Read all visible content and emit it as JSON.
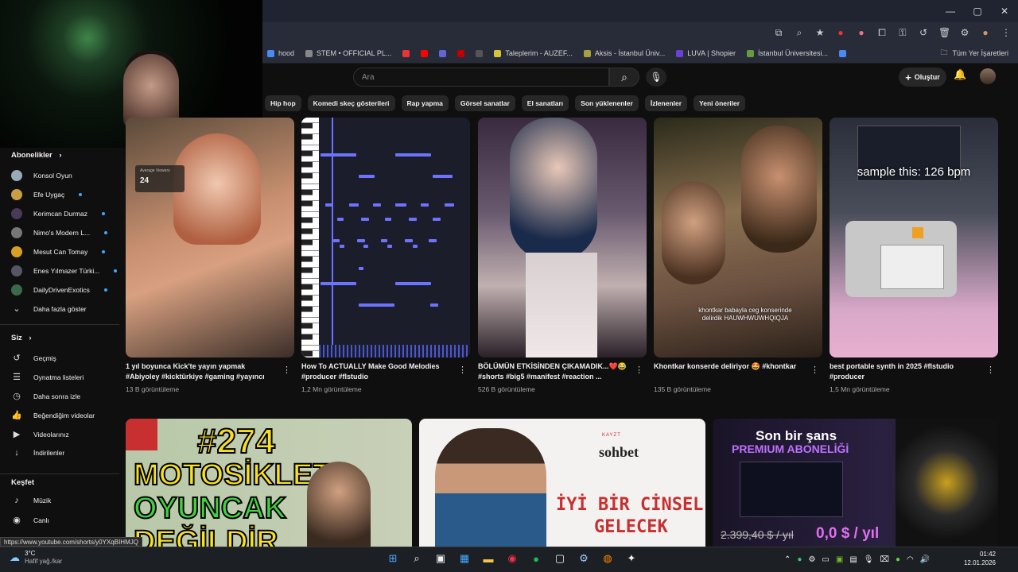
{
  "browser": {
    "window_controls": [
      "—",
      "▢",
      "✕"
    ],
    "bookmarks": [
      {
        "label": "hood",
        "color": "#4a8af4"
      },
      {
        "label": "STEM • OFFICIAL PL...",
        "color": "#888888"
      },
      {
        "label": "",
        "color": "#e33"
      },
      {
        "label": "",
        "color": "#ff0000"
      },
      {
        "label": "",
        "color": "#6264d8"
      },
      {
        "label": "",
        "color": "#c00000"
      },
      {
        "label": "",
        "color": "#555"
      },
      {
        "label": "Taleplerim - AUZEF...",
        "color": "#d4c43a"
      },
      {
        "label": "Aksis - İstanbul Üniv...",
        "color": "#a8a040"
      },
      {
        "label": "LUVA | Shopier",
        "color": "#6b3fd8"
      },
      {
        "label": "İstanbul Üniversitesi...",
        "color": "#6a9a40"
      },
      {
        "label": "",
        "color": "#4a8af4"
      }
    ],
    "all_bookmarks_label": "Tüm Yer İşaretleri",
    "status_url": "https://www.youtube.com/shorts/y0YXqBIHMJQ"
  },
  "header": {
    "search_placeholder": "Ara",
    "create_label": "Oluştur"
  },
  "chips": [
    "Hip hop",
    "Komedi skeç gösterileri",
    "Rap yapma",
    "Görsel sanatlar",
    "El sanatları",
    "Son yüklenenler",
    "İzlenenler",
    "Yeni öneriler"
  ],
  "sidebar": {
    "subscriptions_title": "Abonelikler",
    "subscriptions": [
      {
        "name": "Konsol Oyun",
        "color": "#9ab",
        "live": false
      },
      {
        "name": "Efe Uygaç",
        "color": "#c9a040",
        "live": true
      },
      {
        "name": "Kerimcan Durmaz",
        "color": "#4a3a5a",
        "live": true
      },
      {
        "name": "Nimo's Modern L...",
        "color": "#777",
        "live": true
      },
      {
        "name": "Mesut Can Tomay",
        "color": "#d8a020",
        "live": true
      },
      {
        "name": "Enes Yılmazer Türki...",
        "color": "#556",
        "live": true
      },
      {
        "name": "DailyDrivenExotics",
        "color": "#3a6a4a",
        "live": true
      }
    ],
    "show_more": "Daha fazla göster",
    "you_title": "Siz",
    "you_items": [
      {
        "label": "Geçmiş",
        "icon": "history-icon",
        "glyph": "↺"
      },
      {
        "label": "Oynatma listeleri",
        "icon": "playlist-icon",
        "glyph": "☰"
      },
      {
        "label": "Daha sonra izle",
        "icon": "clock-icon",
        "glyph": "◷"
      },
      {
        "label": "Beğendiğim videolar",
        "icon": "thumbs-up-icon",
        "glyph": "👍"
      },
      {
        "label": "Videolarınız",
        "icon": "video-icon",
        "glyph": "▶"
      },
      {
        "label": "İndirilenler",
        "icon": "download-icon",
        "glyph": "↓"
      }
    ],
    "explore_title": "Keşfet",
    "explore_items": [
      {
        "label": "Müzik",
        "icon": "music-icon",
        "glyph": "♪"
      },
      {
        "label": "Canlı",
        "icon": "live-icon",
        "glyph": "◉"
      }
    ]
  },
  "shorts": [
    {
      "title": "1 yıl boyunca Kick'te yayın yapmak #Abiyoley #kicktürkiye #gaming #yayıncı",
      "views": "13 B görüntüleme",
      "overlay": "24"
    },
    {
      "title": "How To ACTUALLY Make Good Melodies #producer #flstudio",
      "views": "1,2 Mn görüntüleme",
      "overlay": ""
    },
    {
      "title": "BÖLÜMÜN ETKİSİNDEN ÇIKAMADIK...❤️😂 #shorts #big5 #manifest #reaction ...",
      "views": "526 B görüntüleme",
      "overlay": ""
    },
    {
      "title": "Khontkar konserde deliriyor 🤩 #khontkar",
      "views": "135 B görüntüleme",
      "overlay": "khontkar babayla ceg konserinde delirdik HAUWHWUWHQIQJA"
    },
    {
      "title": "best portable synth in 2025 #flstudio #producer",
      "views": "1,5 Mn görüntüleme",
      "overlay": "sample this: 126 bpm"
    }
  ],
  "videos": [
    {
      "thumb_text_1": "#274",
      "thumb_text_2": "MOTOSİKLET",
      "thumb_text_3": "OYUNCAK",
      "thumb_text_4": "DEĞİLDİR"
    },
    {
      "thumb_text_1": "sohbet",
      "thumb_text_2": "İYİ BİR CİNSEL",
      "thumb_text_3": "GELECEK",
      "thumb_text_4": "KAYZT"
    },
    {
      "thumb_text_1": "Son bir şans",
      "thumb_text_2": "PREMIUM ABONELİĞİ",
      "thumb_text_3": "2.399,40 $ / yıl",
      "thumb_text_4": "0,0 $ / yıl"
    }
  ],
  "taskbar": {
    "temperature": "3°C",
    "weather_desc": "Hafif yağ./kar",
    "time": "01:42",
    "date": "12.01.2026"
  }
}
